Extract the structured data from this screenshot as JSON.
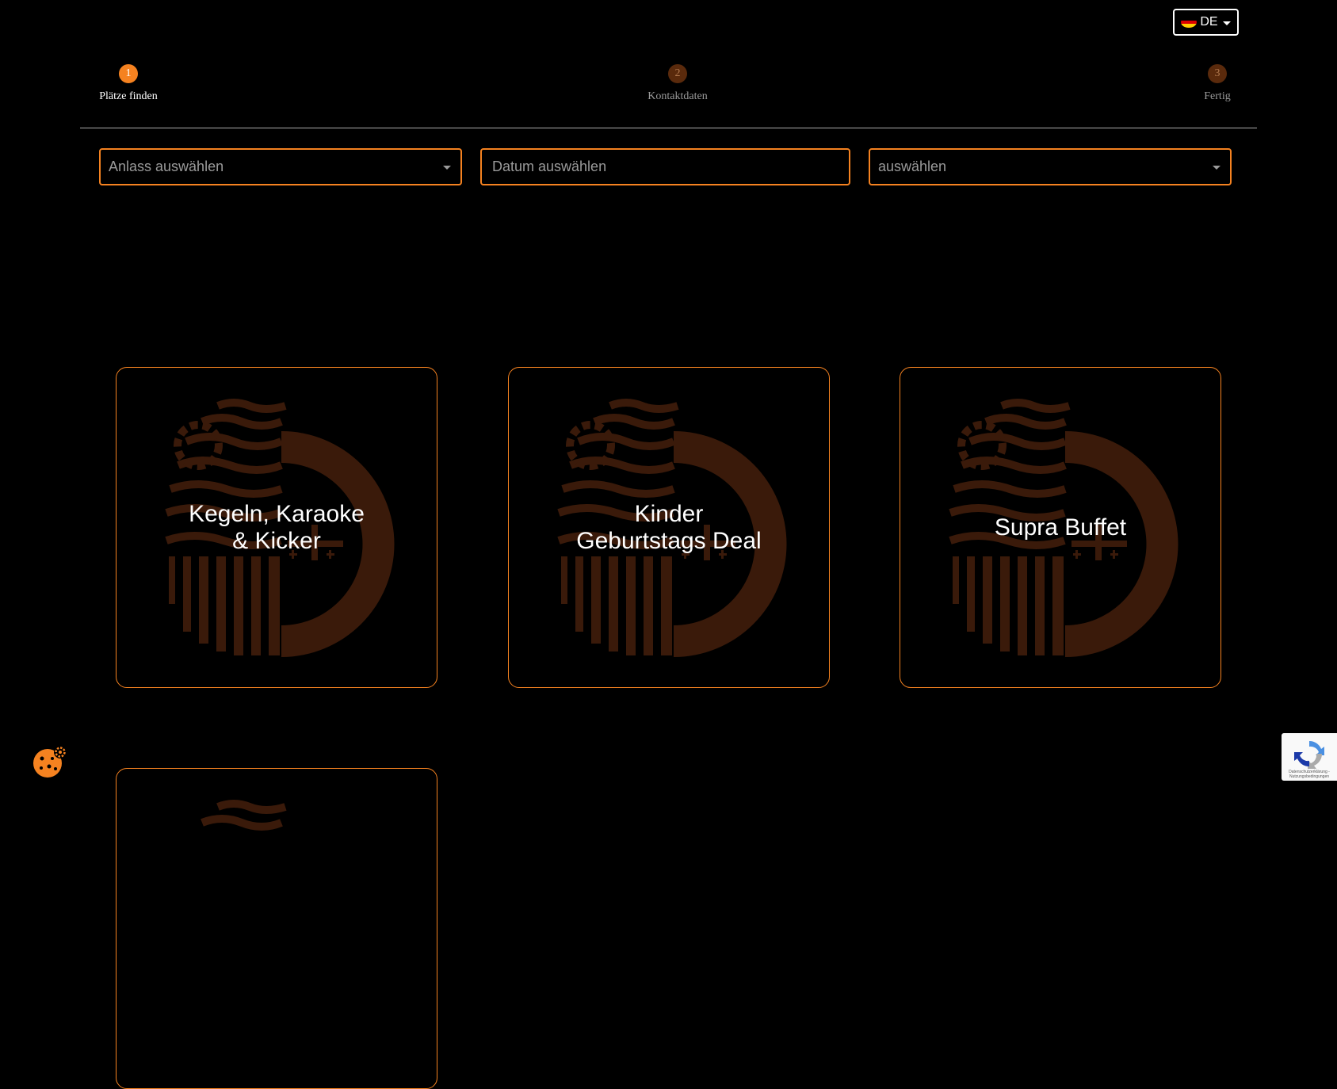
{
  "language_selector": {
    "code": "DE",
    "flag_icon": "germany-flag-icon"
  },
  "steps": [
    {
      "number": "1",
      "label": "Plätze finden",
      "state": "active"
    },
    {
      "number": "2",
      "label": "Kontaktdaten",
      "state": "inactive"
    },
    {
      "number": "3",
      "label": "Fertig",
      "state": "inactive"
    }
  ],
  "filters": {
    "occasion_placeholder": "Anlass auswählen",
    "date_placeholder": "Datum auswählen",
    "third_placeholder": "auswählen"
  },
  "offers": [
    {
      "title": "Kegeln, Karaoke\n& Kicker"
    },
    {
      "title": "Kinder\nGeburtstags Deal"
    },
    {
      "title": "Supra Buffet"
    },
    {
      "title": ""
    }
  ],
  "cookie_button": {
    "icon": "cookie-settings-icon"
  },
  "recaptcha": {
    "icon": "recaptcha-icon",
    "caption": "Datenschutzerklärung - Nutzungsbedingungen"
  },
  "colors": {
    "accent": "#f58220",
    "logo": "#3a1a0a",
    "background": "#000000"
  }
}
